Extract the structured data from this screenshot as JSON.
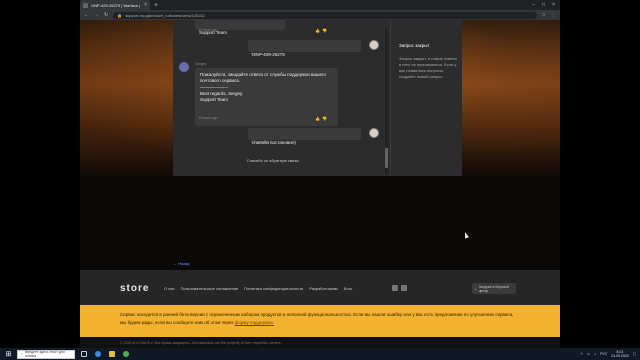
{
  "browser": {
    "tab_title": "ONP-429-26279 | Warface | Su",
    "url": "support.my.games/wf_ru/tickets/view/328162"
  },
  "chat": {
    "messages": [
      {
        "text": "Support Team",
        "time": "8 hours ago"
      },
      {
        "text": "ONP-429-26279",
        "time": "8 hours ago"
      },
      {
        "author": "Sergey",
        "text": "Пожалуйста, ожидайте ответа от службы поддержки вашего почтового сервиса.",
        "regards": "Best regards, Sergey.",
        "team": "Support Team",
        "time": "8 hours ago"
      },
      {
        "text": "спасибо востановил)",
        "time": "8 hours ago"
      }
    ],
    "thanks": "Спасибо за обратную связь!"
  },
  "side": {
    "title": "Запрос закрыт",
    "text": "Запрос закрыт, и новые ответы в него не принимаются. Если у вас появились вопросы, создайте новый запрос."
  },
  "back_link": "← Назад",
  "footer": {
    "logo": "store",
    "links": [
      "О нас",
      "Пользовательское соглашение",
      "Политика конфиденциальности",
      "Разработчикам",
      "Блог"
    ],
    "download": "Загрузить Игровой центр"
  },
  "beta": {
    "text": "Сервис находится в ранней бета-версии с ограниченным набором продуктов и неполной функциональностью. Если вы нашли ошибку или у вас есть предложение по улучшению сервиса, мы будем рады, если вы сообщите нам об этом через",
    "link": "форму поддержки."
  },
  "status": "© 2020 MY.COM B.V. Все права защищены. All trademarks are the property of their respective owners.",
  "taskbar": {
    "search_placeholder": "Введите здесь текст для поиска",
    "time": "8:23",
    "date": "24.09.2020",
    "lang": "РУС"
  }
}
